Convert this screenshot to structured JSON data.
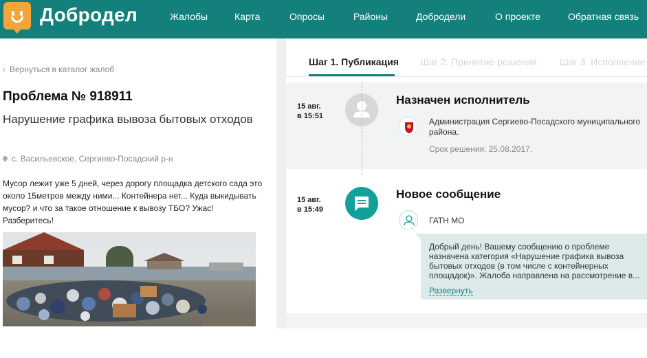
{
  "header": {
    "brand": "Добродел",
    "nav": [
      "Жалобы",
      "Карта",
      "Опросы",
      "Районы",
      "Добродели",
      "О проекте",
      "Обратная связь"
    ]
  },
  "left": {
    "back_link": "Вернуться в каталог жалоб",
    "problem_title": "Проблема № 918911",
    "problem_subtitle": "Нарушение графика вывоза бытовых отходов",
    "location": "с. Васильевское, Сергиево-Посадский р-н",
    "description": "Мусор лежит уже 5 дней, через дорогу площадка детского сада это около 15метров между ними... Контейнера нет... Куда выкидывать мусор? и что за такое отношение к вывозу ТБО? Ужас! Разберитесь!"
  },
  "tabs": [
    "Шаг 1. Публикация",
    "Шаг 2. Принятие решения",
    "Шаг 3. Исполнение"
  ],
  "events": {
    "assigned": {
      "date": "15 авг.",
      "time": "в 15:51",
      "title": "Назначен исполнитель",
      "org": "Администрация Сергиево-Посадского муниципального района.",
      "deadline": "Срок решения: 25.08.2017."
    },
    "message": {
      "date": "15 авг.",
      "time": "в 15:49",
      "title": "Новое сообщение",
      "author": "ГАТН МО",
      "text": "Добрый день! Вашему сообщению о проблеме назначена категория «Нарушение графика вывоза бытовых отходов (в том числе с контейнерных площадок)». Жалоба направлена на рассмотрение в...",
      "expand": "Развернуть"
    }
  },
  "colors": {
    "brand": "#14807c",
    "accent_teal": "#14a09a",
    "logo": "#f4a53a"
  },
  "icons": [
    "smile-logo-icon",
    "chevron-left-icon",
    "location-pin-icon",
    "user-placeholder-icon",
    "message-icon",
    "coat-of-arms-icon",
    "user-outline-icon"
  ]
}
